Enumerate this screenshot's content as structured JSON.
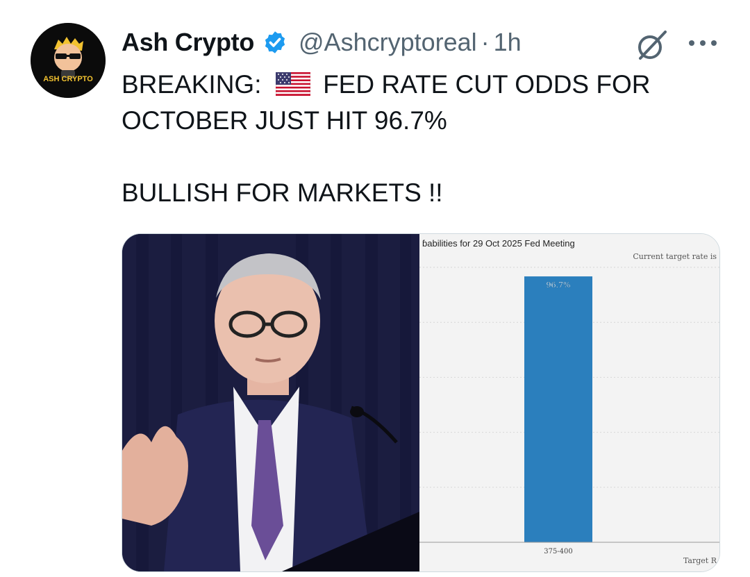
{
  "tweet": {
    "author_name": "Ash Crypto",
    "handle": "@Ashcryptoreal",
    "separator": "·",
    "time": "1h",
    "avatar_text": "ASH CRYPTO",
    "text_line1_prefix": "BREAKING:",
    "text_line1_suffix": "FED RATE CUT ODDS FOR",
    "text_line2": "OCTOBER JUST HIT 96.7%",
    "text_line3": "BULLISH FOR MARKETS !!"
  },
  "colors": {
    "verified_blue": "#1d9bf0",
    "bar_blue": "#2b7fbd",
    "text_secondary": "#536471"
  },
  "icons": {
    "verified": "verified-badge-icon",
    "grok": "grok-icon",
    "more": "more-icon",
    "flag": "us-flag-icon"
  },
  "chart_data": {
    "type": "bar",
    "title": "ɓabilities for 29 Oct 2025 Fed Meeting",
    "annotation": "Current target rate is",
    "xlabel": "Target R",
    "categories": [
      "375-400"
    ],
    "values": [
      96.7
    ],
    "value_labels": [
      "96.7%"
    ],
    "ylim": [
      0,
      100
    ],
    "grid": true
  }
}
